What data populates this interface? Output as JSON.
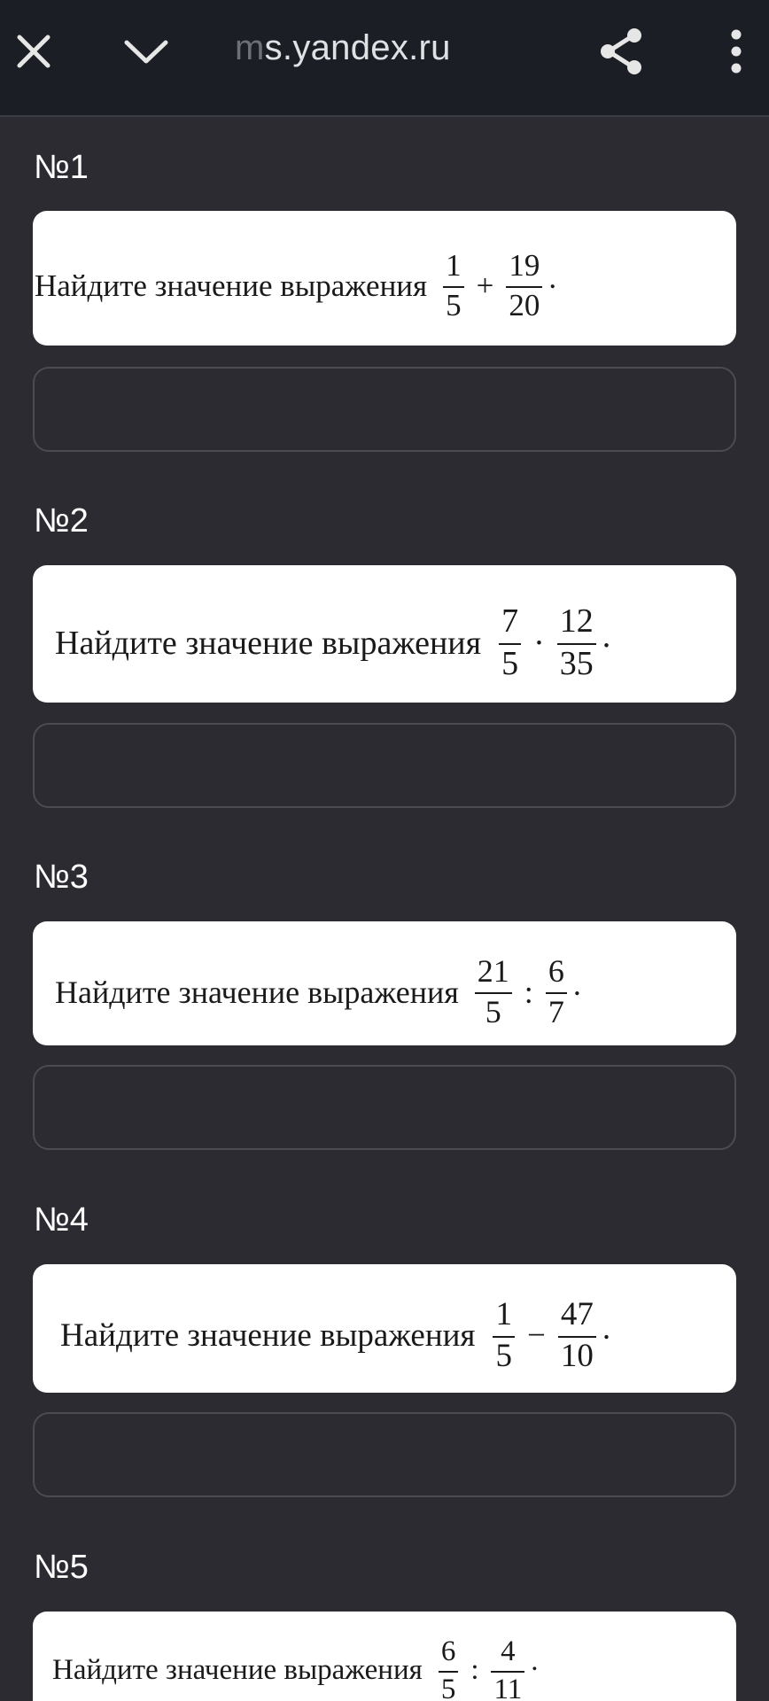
{
  "browser": {
    "url_faded": "m",
    "url_main": "s.yandex.ru",
    "icons": {
      "close": "close-icon",
      "collapse": "chevron-down-icon",
      "share": "share-icon",
      "menu": "more-vertical-icon"
    }
  },
  "tasks": [
    {
      "title": "№1",
      "text": "Найдите значение выражения",
      "a_num": "1",
      "a_den": "5",
      "op": "+",
      "b_num": "19",
      "b_den": "20",
      "end": "."
    },
    {
      "title": "№2",
      "text": "Найдите значение выражения",
      "a_num": "7",
      "a_den": "5",
      "op": "·",
      "b_num": "12",
      "b_den": "35",
      "end": "."
    },
    {
      "title": "№3",
      "text": "Найдите значение выражения",
      "a_num": "21",
      "a_den": "5",
      "op": ":",
      "b_num": "6",
      "b_den": "7",
      "end": "."
    },
    {
      "title": "№4",
      "text": "Найдите значение выражения",
      "a_num": "1",
      "a_den": "5",
      "op": "−",
      "b_num": "47",
      "b_den": "10",
      "end": "."
    },
    {
      "title": "№5",
      "text": "Найдите значение выражения",
      "a_num": "6",
      "a_den": "5",
      "op": ":",
      "b_num": "4",
      "b_den": "11",
      "end": "."
    }
  ],
  "colors": {
    "background": "#2b2b31",
    "topbar": "#1b1e24",
    "card": "#ffffff",
    "input_border": "#4b4c53"
  }
}
